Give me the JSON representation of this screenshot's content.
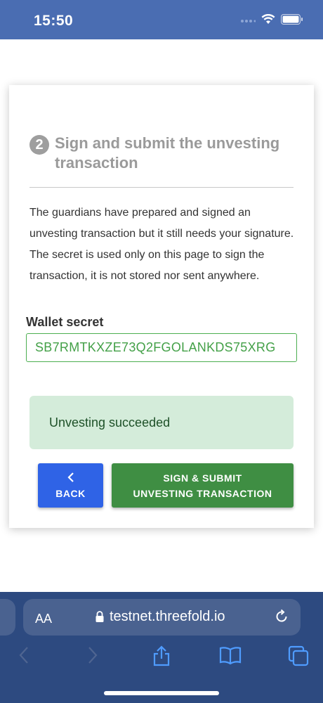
{
  "status_bar": {
    "time": "15:50"
  },
  "step": {
    "number": "2",
    "title": "Sign and submit the unvesting transaction"
  },
  "description": {
    "line1": "The guardians have prepared and signed an unvesting transaction but it still needs your signature.",
    "line2": "The secret is used only on this page to sign the transaction, it is not stored nor sent anywhere."
  },
  "wallet": {
    "label": "Wallet secret",
    "value": "SB7RMTKXZE73Q2FGOLANKDS75XRG"
  },
  "alert": {
    "message": "Unvesting succeeded",
    "color": "#d4ecda"
  },
  "buttons": {
    "back_label": "BACK",
    "submit_label": "SIGN & SUBMIT UNVESTING TRANSACTION",
    "back_color": "#2f63e6",
    "submit_color": "#3f8e43"
  },
  "browser": {
    "aa_label": "AA",
    "url": "testnet.threefold.io",
    "bar_color": "#2d4a80",
    "icons": [
      "back-arrow-icon",
      "forward-arrow-icon",
      "share-icon",
      "bookmarks-icon",
      "tabs-icon",
      "reload-icon",
      "lock-icon"
    ]
  }
}
